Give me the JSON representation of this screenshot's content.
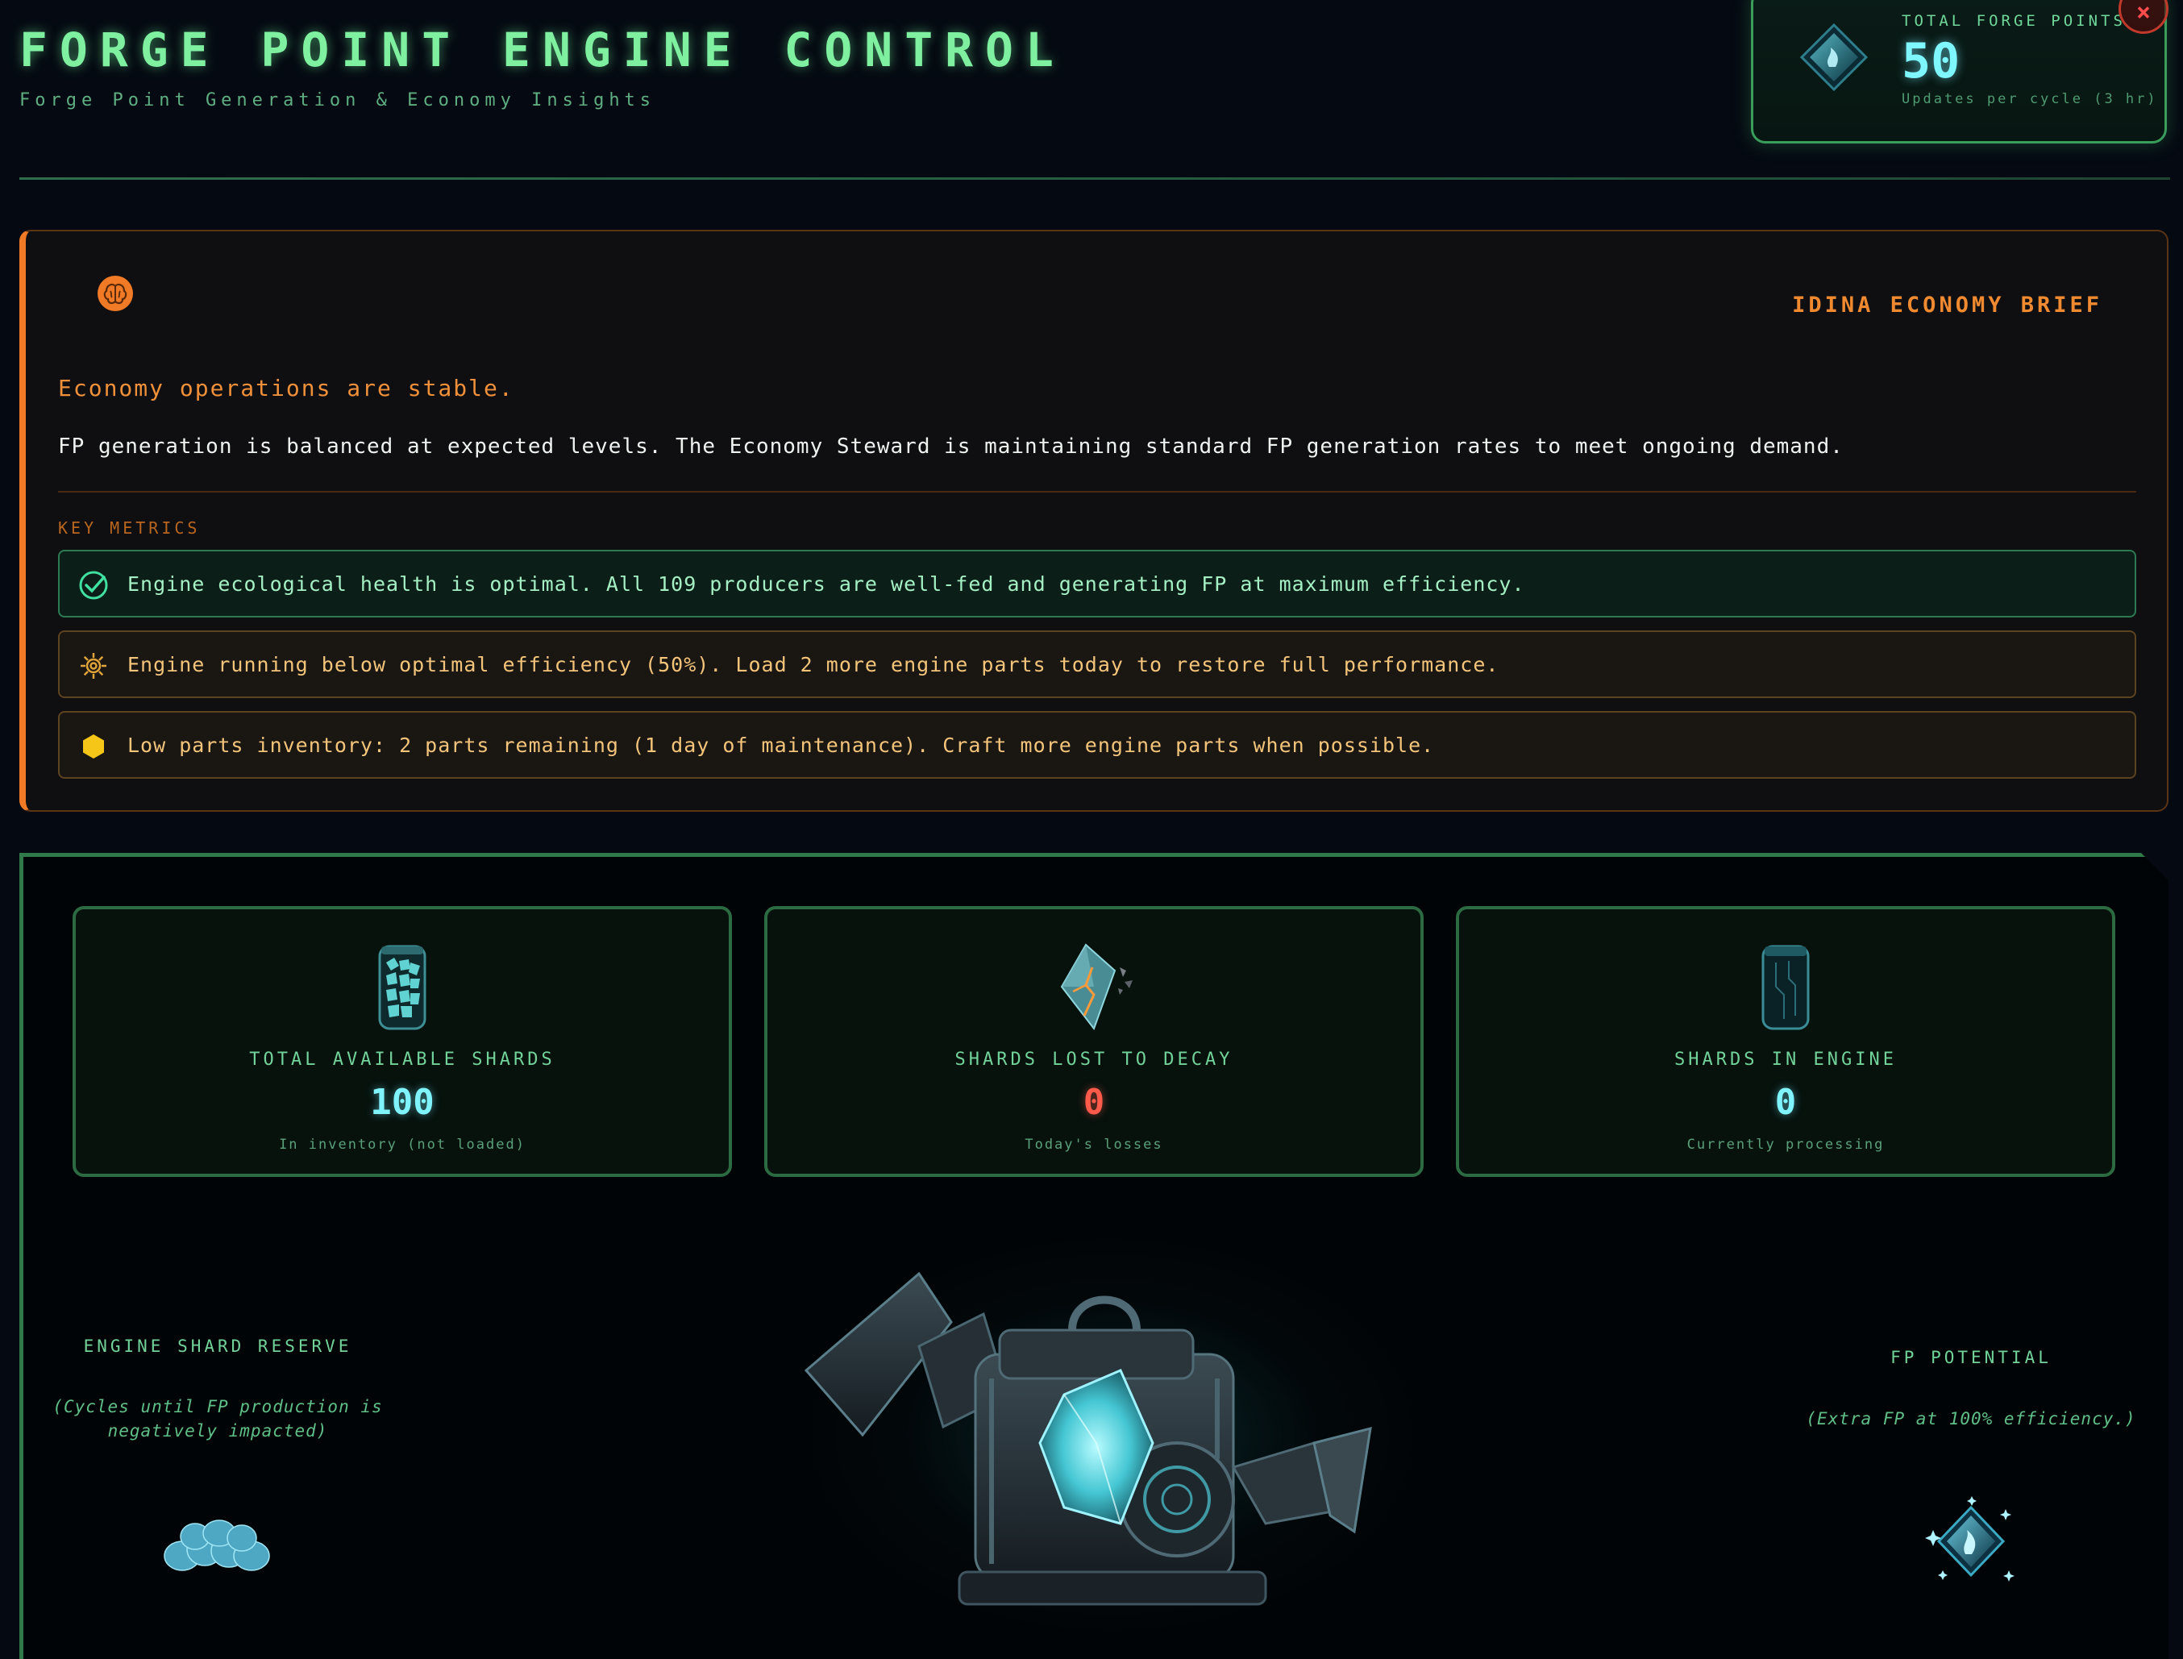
{
  "header": {
    "title": "FORGE POINT ENGINE CONTROL",
    "subtitle": "Forge Point Generation & Economy Insights"
  },
  "fp_widget": {
    "label": "TOTAL FORGE POINTS",
    "value": "50",
    "note": "Updates per cycle (3 hr)",
    "icon": "fp-gem-icon",
    "close_label": "×"
  },
  "brief": {
    "heading": "IDINA ECONOMY BRIEF",
    "icon": "brain-icon",
    "status": "Economy operations are stable.",
    "body": "FP generation is balanced at expected levels. The Economy Steward is maintaining standard FP generation rates to meet ongoing demand.",
    "metrics_label": "KEY METRICS",
    "metrics": [
      {
        "text": "Engine ecological health is optimal. All 109 producers are well-fed and generating FP at maximum efficiency.",
        "type": "ok",
        "icon": "check-circle-icon"
      },
      {
        "text": "Engine running below optimal efficiency (50%). Load 2 more engine parts today to restore full performance.",
        "type": "warn",
        "icon": "gear-icon"
      },
      {
        "text": "Low parts inventory: 2 parts remaining (1 day of maintenance). Craft more engine parts when possible.",
        "type": "warn",
        "icon": "hexagon-icon"
      }
    ]
  },
  "stats": [
    {
      "label": "TOTAL AVAILABLE SHARDS",
      "value": "100",
      "note": "In inventory (not loaded)",
      "icon": "shard-jar-icon"
    },
    {
      "label": "SHARDS LOST TO DECAY",
      "value": "0",
      "note": "Today's losses",
      "icon": "cracked-shard-icon"
    },
    {
      "label": "SHARDS IN ENGINE",
      "value": "0",
      "note": "Currently processing",
      "icon": "empty-canister-icon"
    }
  ],
  "reserve": {
    "label": "ENGINE SHARD RESERVE",
    "note": "(Cycles until FP production is negatively impacted)",
    "icon": "shard-pile-icon"
  },
  "potential": {
    "label": "FP POTENTIAL",
    "note": "(Extra FP at 100% efficiency.)",
    "icon": "sparkling-fp-gem-icon"
  },
  "engine_art": "forge-engine-icon",
  "colors": {
    "accent_green": "#7ef0a0",
    "accent_orange": "#f07a26",
    "value_cyan": "#7ff4ff",
    "value_red": "#ff5a4a",
    "background": "#050a12"
  }
}
